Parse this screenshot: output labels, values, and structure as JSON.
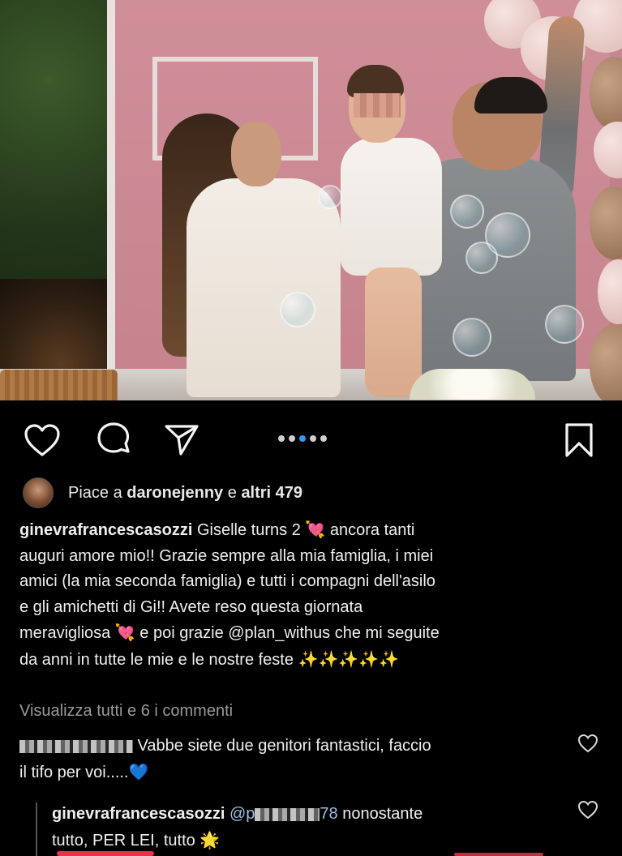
{
  "post": {
    "image_alt": "Famiglia con bambina davanti a una parete rosa con bolle di sapone",
    "carousel": {
      "count": 5,
      "active_index": 3
    }
  },
  "actions": {
    "like_icon": "heart-outline-icon",
    "comment_icon": "comment-bubble-icon",
    "share_icon": "paper-plane-icon",
    "save_icon": "bookmark-icon"
  },
  "likes": {
    "prefix": "Piace a ",
    "user": "daronejenny",
    "middle": " e ",
    "others": "altri 479"
  },
  "caption": {
    "username": "ginevrafrancescasozzi",
    "line1_text": " Giselle turns 2 ",
    "line1_emoji": "💘",
    "line1_after": " ancora tanti",
    "line2": "auguri amore mio!! Grazie sempre alla mia famiglia, i miei",
    "line3": "amici (la mia seconda famiglia) e tutti i compagni dell'asilo",
    "line4": "e gli amichetti di Gi!! Avete reso questa giornata",
    "line5_text": "meravigliosa ",
    "line5_emoji": "💘",
    "line5_after": " e poi grazie @plan_withus che mi seguite",
    "line6_text": "da anni in tutte le mie e le nostre feste ",
    "line6_emoji": "✨✨✨✨✨"
  },
  "view_comments": "Visualizza tutti e 6 i commenti",
  "comments": [
    {
      "username_masked": true,
      "line1_text": " Vabbe siete due genitori  fantastici,  faccio",
      "line2_text": "il tifo per voi.....",
      "line2_emoji": "💙"
    },
    {
      "username": "ginevrafrancescasozzi",
      "mention_prefix": " @p",
      "mention_suffix": "78",
      "line1_after": " nonostante",
      "line2_text": "tutto, PER LEI, tutto ",
      "line2_emoji": "🌟"
    }
  ]
}
